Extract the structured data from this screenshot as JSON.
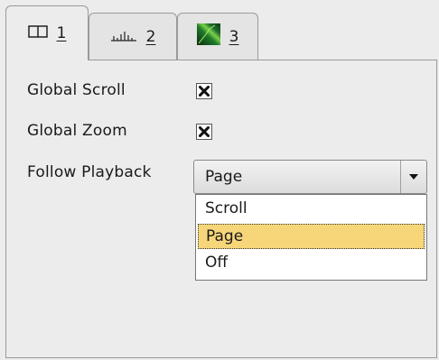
{
  "tabs": [
    {
      "icon": "split-panels-icon",
      "label": "1",
      "active": true
    },
    {
      "icon": "waveform-icon",
      "label": "2",
      "active": false
    },
    {
      "icon": "spectrogram-icon",
      "label": "3",
      "active": false
    }
  ],
  "settings": {
    "global_scroll_label": "Global Scroll",
    "global_scroll_checked": true,
    "global_zoom_label": "Global Zoom",
    "global_zoom_checked": true,
    "follow_playback_label": "Follow Playback",
    "follow_playback_value": "Page",
    "follow_playback_options": [
      "Scroll",
      "Page",
      "Off"
    ],
    "follow_playback_selected_index": 1
  },
  "colors": {
    "background": "#ececec",
    "highlight": "#f7d67a"
  }
}
